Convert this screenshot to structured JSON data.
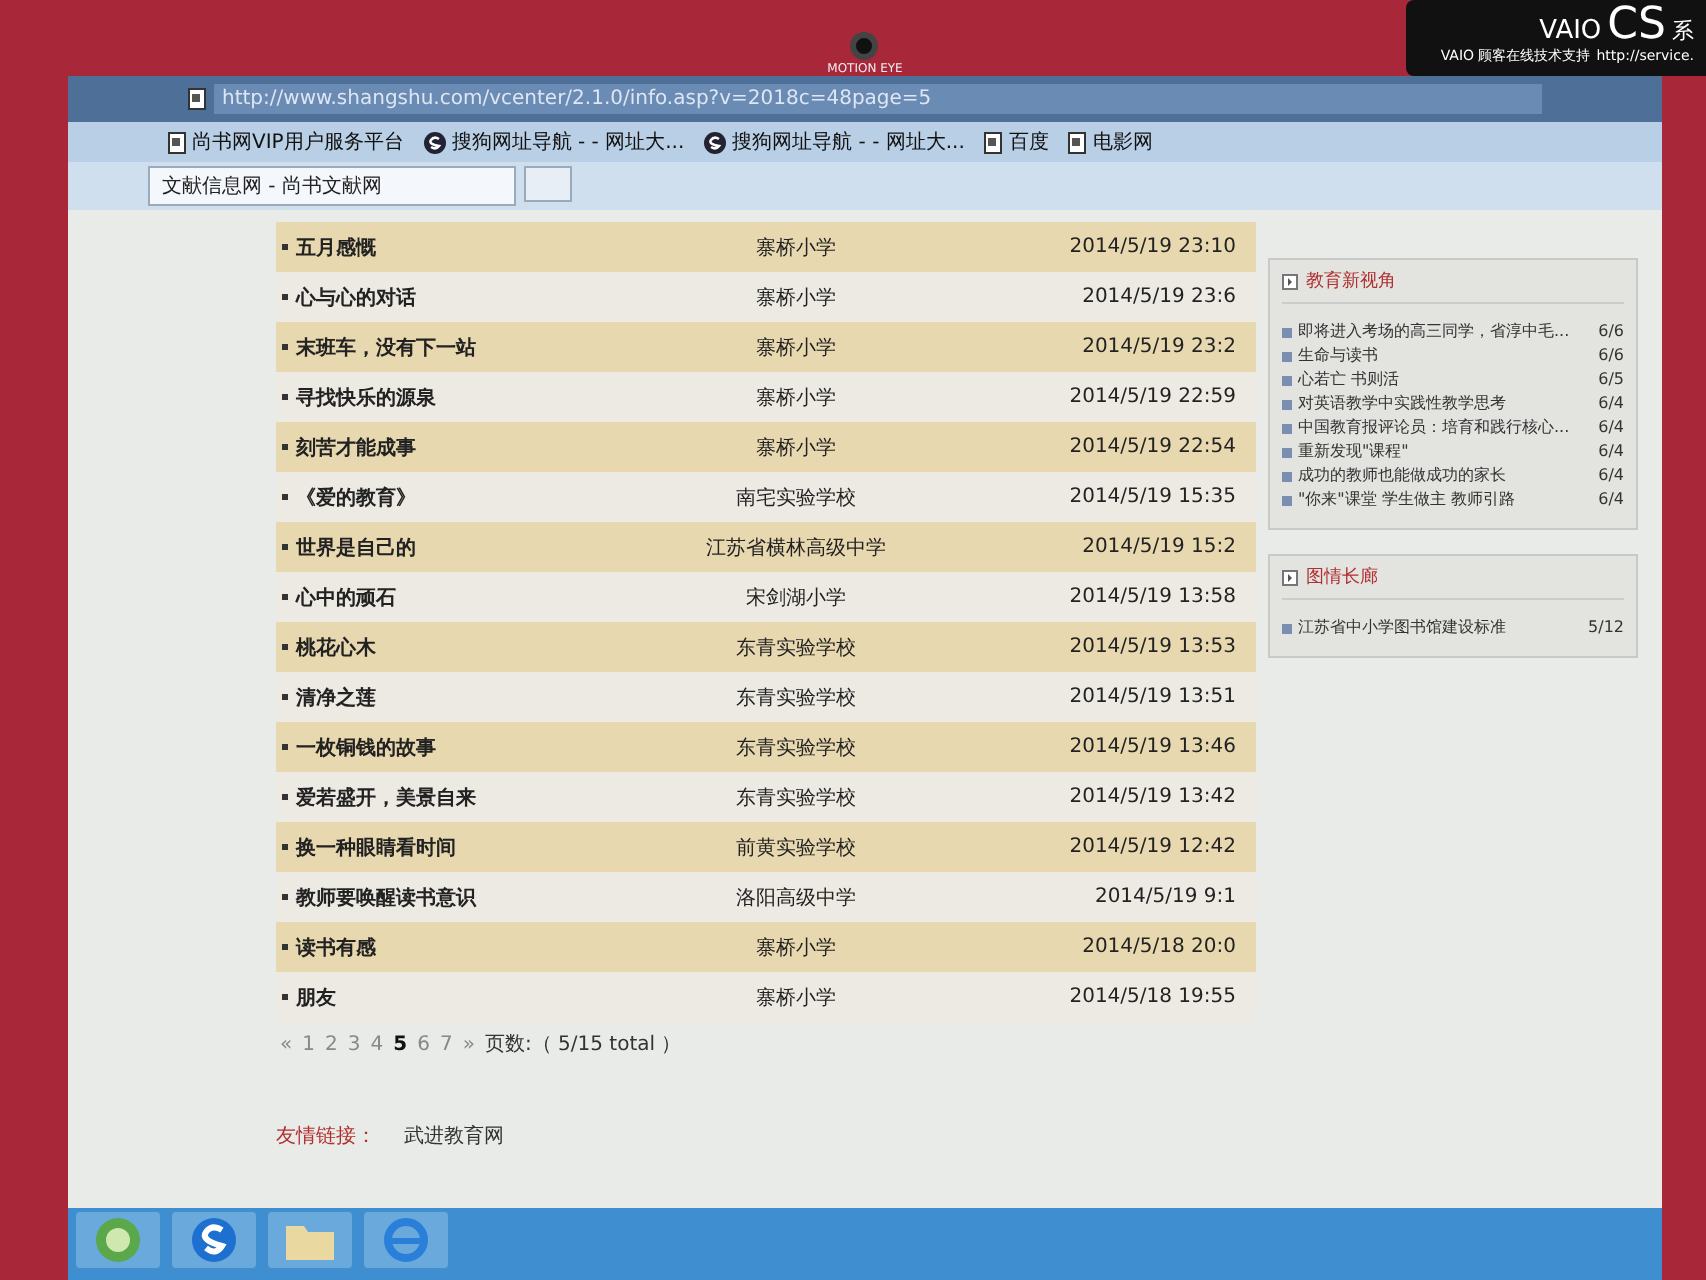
{
  "bezel": {
    "camera_label": "MOTION EYE",
    "sticker": {
      "brand": "VAIO",
      "model": "CS",
      "model_suffix": "系",
      "support": "VAIO 顾客在线技术支持",
      "url": "http://service."
    }
  },
  "browser": {
    "address": "http://www.shangshu.com/vcenter/2.1.0/info.asp?v=2018c=48page=5",
    "favorites": [
      {
        "label": "尚书网VIP用户服务平台",
        "kind": "page"
      },
      {
        "label": "搜狗网址导航 - - 网址大...",
        "kind": "sogou"
      },
      {
        "label": "搜狗网址导航 - - 网址大...",
        "kind": "sogou"
      },
      {
        "label": "百度",
        "kind": "page"
      },
      {
        "label": "电影网",
        "kind": "page"
      }
    ],
    "tabs": [
      {
        "label": "文献信息网 - 尚书文献网",
        "selected": true
      }
    ]
  },
  "articles": [
    {
      "title": "五月感慨",
      "school": "寨桥小学",
      "time": "2014/5/19 23:10"
    },
    {
      "title": "心与心的对话",
      "school": "寨桥小学",
      "time": "2014/5/19 23:6"
    },
    {
      "title": "末班车，没有下一站",
      "school": "寨桥小学",
      "time": "2014/5/19 23:2"
    },
    {
      "title": "寻找快乐的源泉",
      "school": "寨桥小学",
      "time": "2014/5/19 22:59"
    },
    {
      "title": "刻苦才能成事",
      "school": "寨桥小学",
      "time": "2014/5/19 22:54"
    },
    {
      "title": "《爱的教育》",
      "school": "南宅实验学校",
      "time": "2014/5/19 15:35"
    },
    {
      "title": "世界是自己的",
      "school": "江苏省横林高级中学",
      "time": "2014/5/19 15:2"
    },
    {
      "title": "心中的顽石",
      "school": "宋剑湖小学",
      "time": "2014/5/19 13:58"
    },
    {
      "title": "桃花心木",
      "school": "东青实验学校",
      "time": "2014/5/19 13:53"
    },
    {
      "title": "清净之莲",
      "school": "东青实验学校",
      "time": "2014/5/19 13:51"
    },
    {
      "title": "一枚铜钱的故事",
      "school": "东青实验学校",
      "time": "2014/5/19 13:46"
    },
    {
      "title": "爱若盛开，美景自来",
      "school": "东青实验学校",
      "time": "2014/5/19 13:42"
    },
    {
      "title": "换一种眼睛看时间",
      "school": "前黄实验学校",
      "time": "2014/5/19 12:42"
    },
    {
      "title": "教师要唤醒读书意识",
      "school": "洛阳高级中学",
      "time": "2014/5/19 9:1"
    },
    {
      "title": "读书有感",
      "school": "寨桥小学",
      "time": "2014/5/18 20:0"
    },
    {
      "title": "朋友",
      "school": "寨桥小学",
      "time": "2014/5/18 19:55"
    }
  ],
  "pager": {
    "prev": "«",
    "pages": [
      {
        "label": "1",
        "selected": false
      },
      {
        "label": "2",
        "selected": false
      },
      {
        "label": "3",
        "selected": false
      },
      {
        "label": "4",
        "selected": false
      },
      {
        "label": "5",
        "selected": true
      },
      {
        "label": "6",
        "selected": false
      },
      {
        "label": "7",
        "selected": false
      }
    ],
    "next": "»",
    "summary": "页数:（ 5/15 total ）"
  },
  "sidebar": [
    {
      "title": "教育新视角",
      "items": [
        {
          "title": "即将进入考场的高三同学，省淳中毛...",
          "date": "6/6"
        },
        {
          "title": "生命与读书",
          "date": "6/6"
        },
        {
          "title": "心若亡 书则活",
          "date": "6/5"
        },
        {
          "title": "对英语教学中实践性教学思考",
          "date": "6/4"
        },
        {
          "title": "中国教育报评论员：培育和践行核心...",
          "date": "6/4"
        },
        {
          "title": "重新发现\"课程\"",
          "date": "6/4"
        },
        {
          "title": "成功的教师也能做成功的家长",
          "date": "6/4"
        },
        {
          "title": "\"你来\"课堂 学生做主 教师引路",
          "date": "6/4"
        }
      ]
    },
    {
      "title": "图情长廊",
      "items": [
        {
          "title": "江苏省中小学图书馆建设标准",
          "date": "5/12"
        }
      ]
    }
  ],
  "footer": {
    "label": "友情链接：",
    "links": [
      "武进教育网"
    ]
  },
  "taskbar": [
    {
      "kind": "start"
    },
    {
      "kind": "sogou"
    },
    {
      "kind": "folder"
    },
    {
      "kind": "ie"
    }
  ]
}
